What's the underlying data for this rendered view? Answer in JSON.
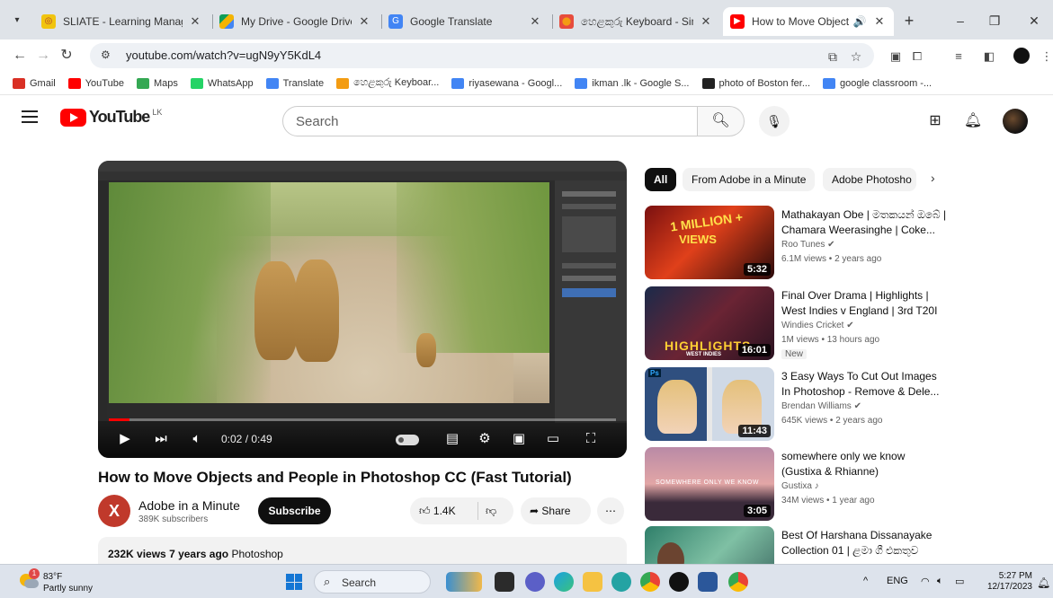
{
  "browser": {
    "tabs": [
      {
        "title": "SLIATE - Learning Managem",
        "favicon": "sliate-icon",
        "active": false
      },
      {
        "title": "My Drive - Google Drive",
        "favicon": "google-drive-icon",
        "active": false
      },
      {
        "title": "Google Translate",
        "favicon": "google-translate-icon",
        "active": false
      },
      {
        "title": "හෙළකුරු Keyboard - Sinha",
        "favicon": "helakuru-icon",
        "active": false
      },
      {
        "title": "How to Move Objects a",
        "favicon": "youtube-icon",
        "active": true,
        "audio": true
      }
    ],
    "new_tab": "+",
    "url": "youtube.com/watch?v=ugN9yY5KdL4",
    "bookmarks": [
      {
        "label": "Gmail",
        "icon": "gmail-icon",
        "color": "#d93025"
      },
      {
        "label": "YouTube",
        "icon": "youtube-icon",
        "color": "#ff0000"
      },
      {
        "label": "Maps",
        "icon": "maps-icon",
        "color": "#34a853"
      },
      {
        "label": "WhatsApp",
        "icon": "whatsapp-icon",
        "color": "#25d366"
      },
      {
        "label": "Translate",
        "icon": "translate-icon",
        "color": "#4285f4"
      },
      {
        "label": "හෙළකුරු Keyboar...",
        "icon": "helakuru-icon",
        "color": "#f39c12"
      },
      {
        "label": "riyasewana - Googl...",
        "icon": "google-icon",
        "color": "#4285f4"
      },
      {
        "label": "ikman .lk - Google S...",
        "icon": "google-icon",
        "color": "#4285f4"
      },
      {
        "label": "photo of Boston fer...",
        "icon": "bookmark-page-icon",
        "color": "#222222"
      },
      {
        "label": "google classroom -...",
        "icon": "google-icon",
        "color": "#4285f4"
      }
    ]
  },
  "youtube": {
    "logo_text": "YouTube",
    "country_code": "LK",
    "search_placeholder": "Search",
    "accent": "#ff0000"
  },
  "player": {
    "time": "0:02 / 0:49",
    "progress": 0.04
  },
  "video": {
    "title": "How to Move Objects and People in Photoshop CC (Fast Tutorial)",
    "channel": "Adobe in a Minute",
    "channel_initial": "X",
    "subscribers": "389K subscribers",
    "subscribe_label": "Subscribe",
    "likes": "1.4K",
    "share_label": "Share",
    "views": "232K views",
    "age": "7 years ago",
    "tag": "Photoshop"
  },
  "chips": [
    "All",
    "From Adobe in a Minute",
    "Adobe Photosho"
  ],
  "recommendations": [
    {
      "title": "Mathakayan Obe | මතකයන් ඔබේ | Chamara Weerasinghe | Coke...",
      "channel": "Roo Tunes",
      "verified": true,
      "meta": "6.1M views • 2 years ago",
      "duration": "5:32"
    },
    {
      "title": "Final Over Drama | Highlights | West Indies v England | 3rd T20I",
      "channel": "Windies Cricket",
      "verified": true,
      "meta": "1M views • 13 hours ago",
      "duration": "16:01",
      "badge": "New"
    },
    {
      "title": "3 Easy Ways To Cut Out Images In Photoshop - Remove & Dele...",
      "channel": "Brendan Williams",
      "verified": true,
      "meta": "645K views • 2 years ago",
      "duration": "11:43"
    },
    {
      "title": "somewhere only we know (Gustixa & Rhianne)",
      "channel": "Gustixa ♪",
      "verified": false,
      "meta": "34M views • 1 year ago",
      "duration": "3:05"
    },
    {
      "title": "Best Of Harshana Dissanayake Collection 01 | ළමා ගී එකතුව",
      "channel": "",
      "verified": false,
      "meta": "",
      "duration": ""
    }
  ],
  "thumb_text": {
    "rec1_top": "1 MILLION +",
    "rec1_sub": "VIEWS",
    "rec2": "HIGHLIGHTS",
    "rec2_sub": "WEST INDIES",
    "rec4": "SOMEWHERE ONLY WE KNOW"
  },
  "taskbar": {
    "temp": "83°F",
    "weather": "Partly sunny",
    "weather_badge": "1",
    "search": "Search",
    "lang": "ENG",
    "time": "5:27 PM",
    "date": "12/17/2023"
  }
}
